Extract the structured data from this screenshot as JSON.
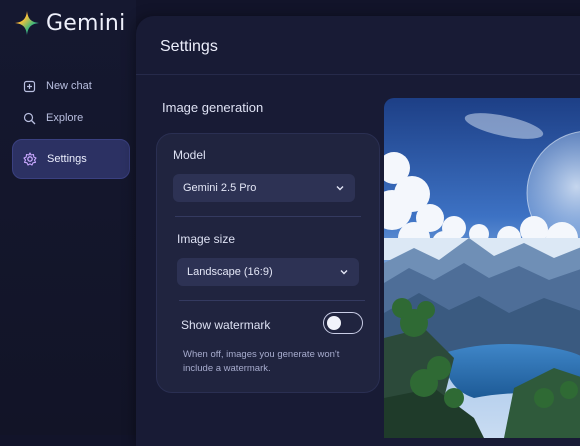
{
  "brand": {
    "name": "Gemini",
    "icon": "gemini-sparkle-icon"
  },
  "sidebar": {
    "items": [
      {
        "label": "New chat",
        "icon": "new-chat-icon",
        "active": false
      },
      {
        "label": "Explore",
        "icon": "explore-icon",
        "active": false
      },
      {
        "label": "Settings",
        "icon": "gear-icon",
        "active": true
      }
    ]
  },
  "header": {
    "title": "Settings"
  },
  "section": {
    "title": "Image generation"
  },
  "settings": {
    "model_label": "Model",
    "model_value": "Gemini 2.5 Pro",
    "size_label": "Image size",
    "size_value": "Landscape (16:9)",
    "watermark_label": "Show watermark",
    "watermark_on": false,
    "watermark_help": "When off, images you generate won't include a watermark."
  },
  "preview": {
    "content": "generated landscape image with planets, clouds and mountains"
  },
  "colors": {
    "background": "#12142a",
    "panel": "#181b35",
    "card": "#20243f",
    "active_nav": "#2c3163",
    "gemini_blue": "#4f8df7",
    "gemini_red": "#ef5a4c",
    "gemini_yellow": "#f6c33c",
    "gemini_green": "#3fb77a"
  }
}
